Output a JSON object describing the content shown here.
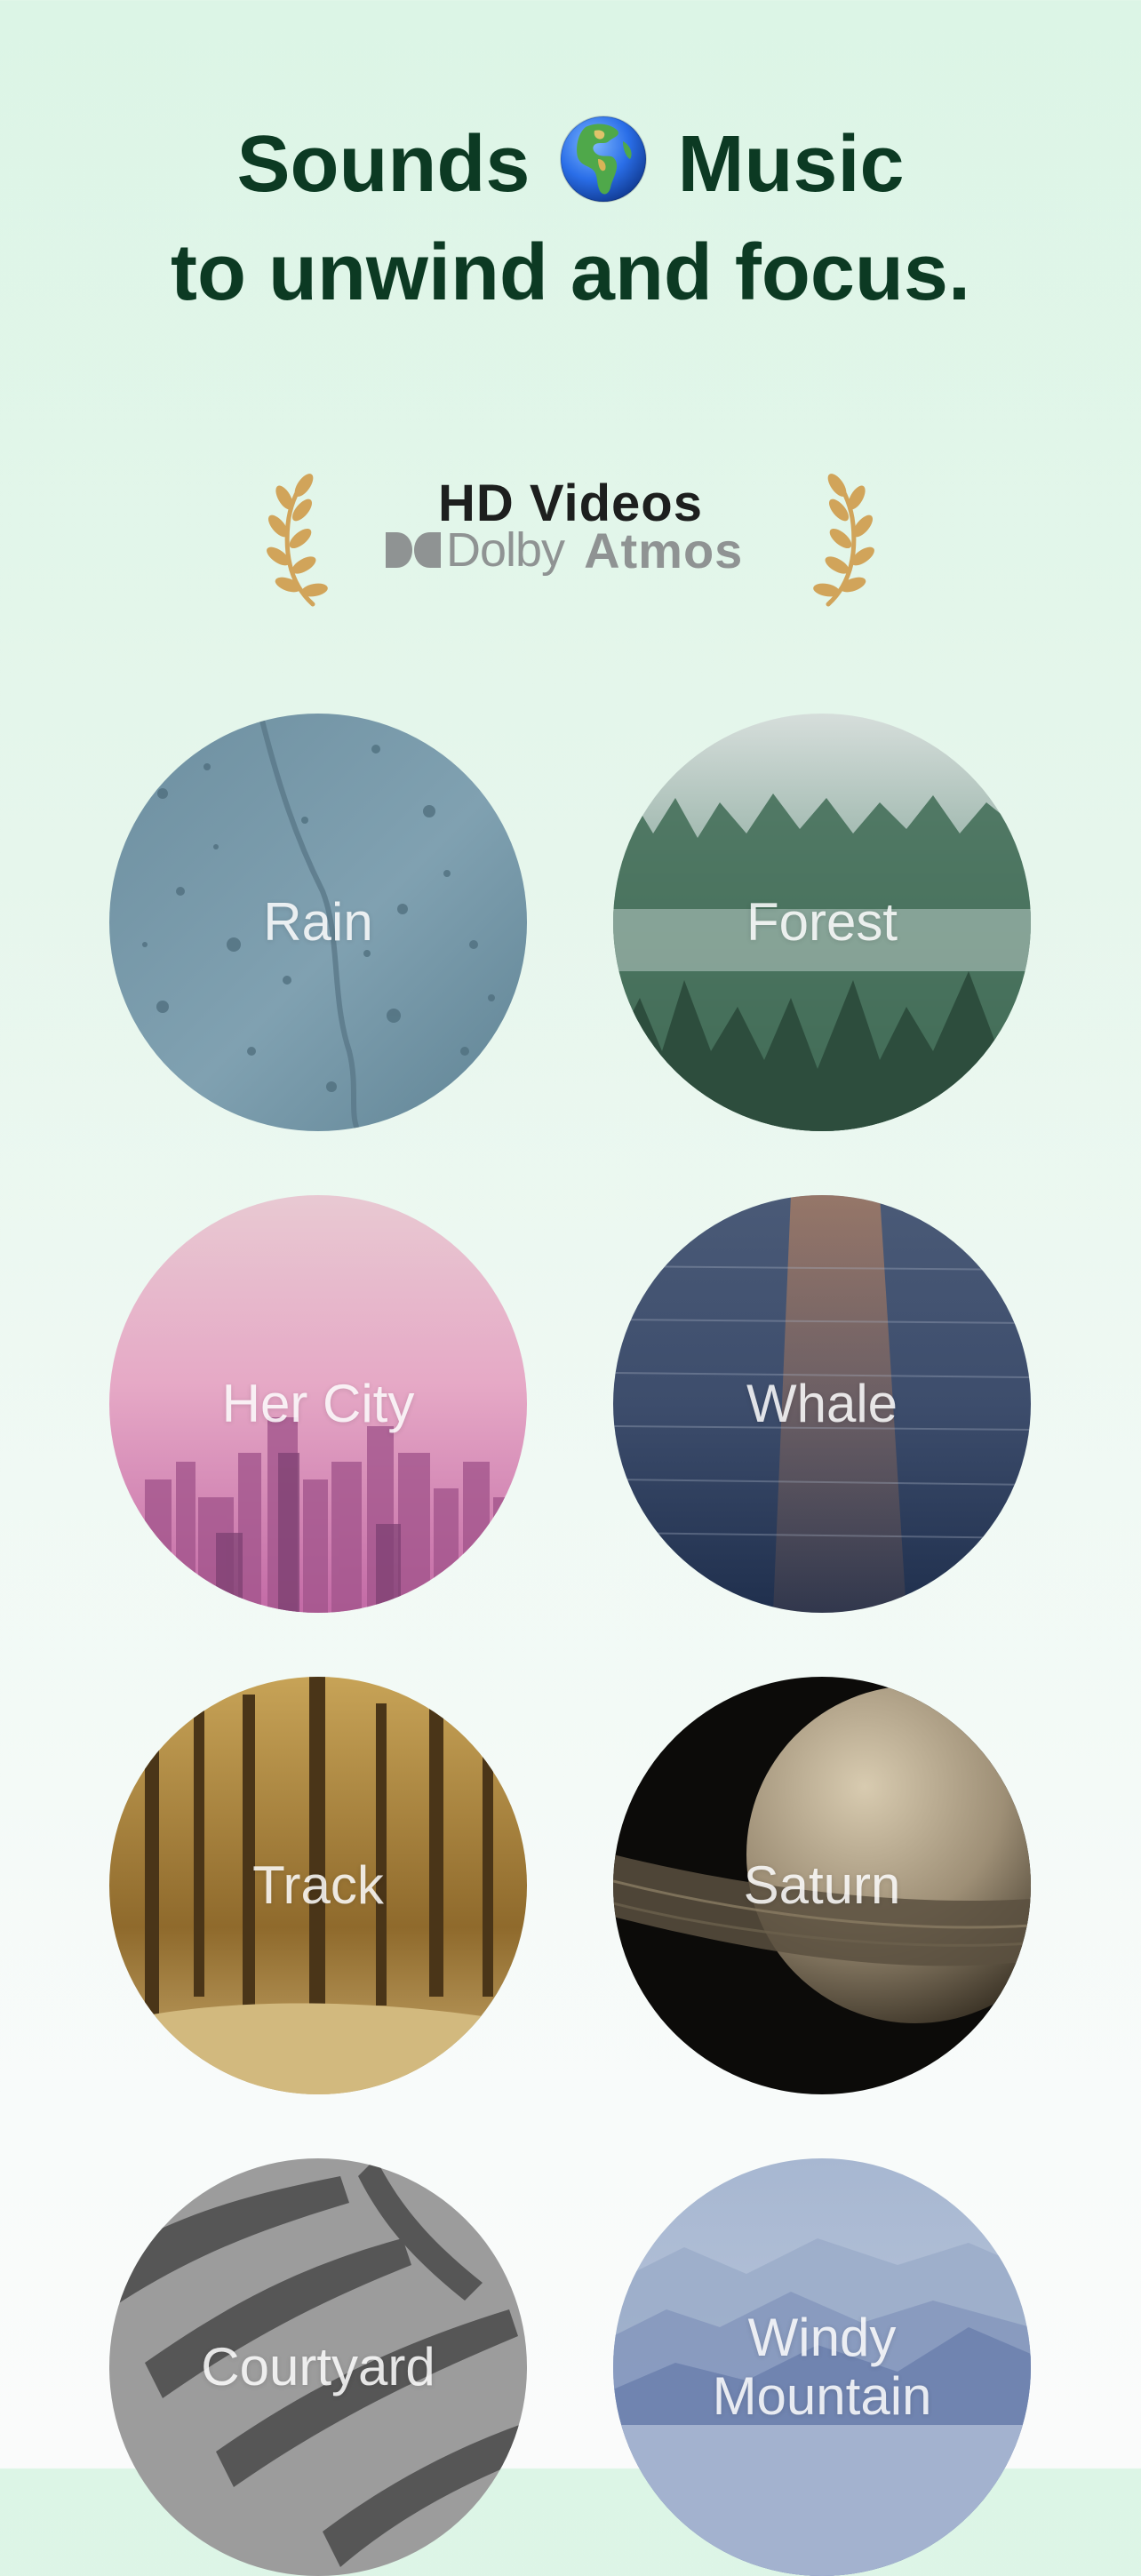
{
  "header": {
    "line1_left": "Sounds",
    "line1_icon": "globe-icon",
    "line1_right": "Music",
    "line2": "to unwind and focus."
  },
  "badge": {
    "title": "HD Videos",
    "dolby_brand": "Dolby",
    "dolby_product": "Atmos",
    "left_icon": "laurel-left-icon",
    "right_icon": "laurel-right-icon",
    "laurel_color": "#d1a45a"
  },
  "colors": {
    "title": "#0c3a23",
    "background_top": "#dcf5e6",
    "background_bottom": "#fafbfb",
    "dolby_gray": "#8f9393"
  },
  "sounds": [
    {
      "label": "Rain",
      "image": "rain-on-glass"
    },
    {
      "label": "Forest",
      "image": "misty-forest"
    },
    {
      "label": "Her City",
      "image": "pink-city-skyline"
    },
    {
      "label": "Whale",
      "image": "ocean-sunset"
    },
    {
      "label": "Track",
      "image": "autumn-forest-path"
    },
    {
      "label": "Saturn",
      "image": "saturn-planet"
    },
    {
      "label": "Courtyard",
      "image": "palm-leaf-shadows"
    },
    {
      "label": "Windy\nMountain",
      "image": "blue-mountains"
    }
  ]
}
